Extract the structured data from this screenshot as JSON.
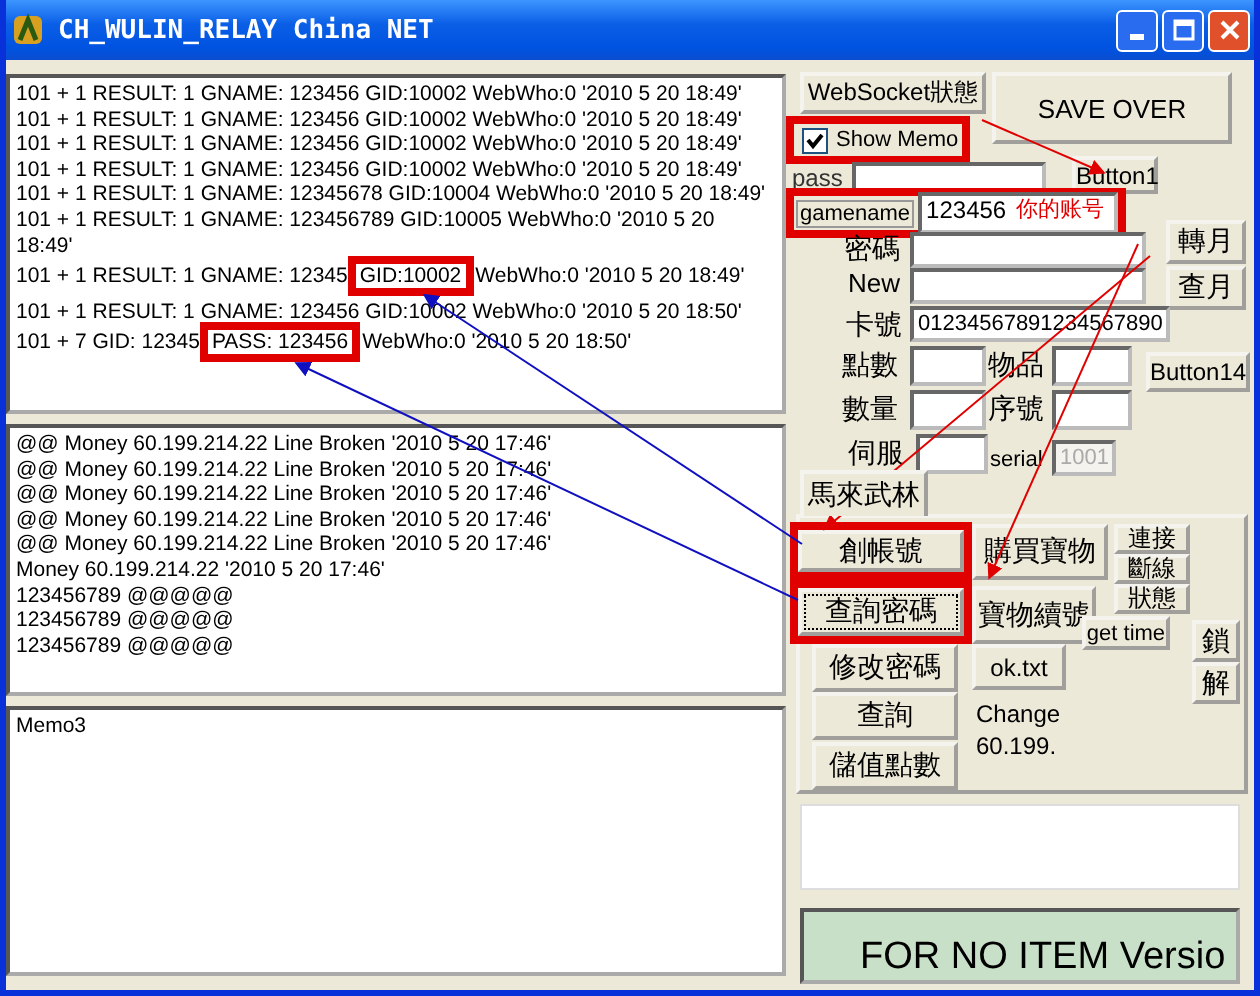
{
  "window": {
    "title": "CH_WULIN_RELAY China NET"
  },
  "log_memo": {
    "lines": [
      {
        "text": "101 + 1 RESULT: 1  GNAME: 123456 GID:10002 WebWho:0 '2010 5 20 18:49'"
      },
      {
        "text": "101 + 1 RESULT: 1  GNAME: 123456 GID:10002 WebWho:0 '2010 5 20 18:49'"
      },
      {
        "text": "101 + 1 RESULT: 1  GNAME: 123456 GID:10002 WebWho:0 '2010 5 20 18:49'"
      },
      {
        "text": "101 + 1 RESULT: 1  GNAME: 123456 GID:10002 WebWho:0 '2010 5 20 18:49'"
      },
      {
        "text": "101 + 1 RESULT: 1  GNAME: 12345678 GID:10004 WebWho:0 '2010 5 20 18:49'"
      },
      {
        "text": "101 + 1 RESULT: 1  GNAME: 123456789 GID:10005 WebWho:0 '2010 5 20 18:49'"
      },
      {
        "text": "101 + 1 RESULT: 1  GNAME: 12345",
        "highlight": "GID:10002",
        "after": "WebWho:0 '2010 5 20 18:49'"
      },
      {
        "text": "101 + 1 RESULT: 1  GNAME: 123456 GID:10002 WebWho:0 '2010 5 20 18:50'"
      },
      {
        "text": "101 + 7 GID: 12345",
        "highlight": "PASS: 123456",
        "after": "WebWho:0 '2010 5 20 18:50'"
      }
    ]
  },
  "money_memo": {
    "lines": [
      "@@ Money  60.199.214.22 Line Broken  '2010 5 20 17:46'",
      "@@ Money  60.199.214.22 Line Broken  '2010 5 20 17:46'",
      "@@ Money  60.199.214.22 Line Broken  '2010 5 20 17:46'",
      "@@ Money  60.199.214.22 Line Broken  '2010 5 20 17:46'",
      "@@ Money  60.199.214.22 Line Broken  '2010 5 20 17:46'",
      " Money 60.199.214.22 '2010 5 20 17:46'",
      "123456789 @@@@@",
      "123456789 @@@@@",
      "123456789 @@@@@"
    ]
  },
  "memo3": {
    "text": "Memo3"
  },
  "websocket_button": "WebSocket狀態",
  "save_button": "SAVE OVER",
  "show_memo": {
    "label": "Show Memo",
    "checked": true,
    "annotated": true
  },
  "pass_label": "pass",
  "button1": "Button1",
  "gamename": {
    "label": "gamename",
    "value": "123456",
    "note": "你的账号",
    "annotated": true
  },
  "password_label": "密碼",
  "new_label": "New",
  "month_buttons": [
    "轉月",
    "查月"
  ],
  "card": {
    "label": "卡號",
    "value": "01234567891234567890"
  },
  "points_label": "點數",
  "item_label": "物品",
  "button14": "Button14",
  "quantity_label": "數量",
  "serial_no_label": "序號",
  "server_label": "伺服",
  "serial": {
    "label": "serial",
    "value": "1001",
    "disabled": true
  },
  "tab": {
    "label": "馬來武林",
    "selected": true
  },
  "create_account": {
    "label": "創帳號",
    "annotated": true
  },
  "buy_item": "購買寶物",
  "connect_buttons": [
    "連接",
    "斷線",
    "狀態"
  ],
  "query_password": {
    "label": "查詢密碼",
    "annotated": true,
    "focused": true
  },
  "item_renew": "寶物續號",
  "get_time": "get time",
  "lock_buttons": [
    "鎖",
    "解"
  ],
  "change_password": "修改密碼",
  "ok_txt": "ok.txt",
  "query": "查詢",
  "change_label": "Change",
  "ip_label": "60.199.",
  "store_points": "儲值點數",
  "version_banner": "FOR NO ITEM Versio"
}
